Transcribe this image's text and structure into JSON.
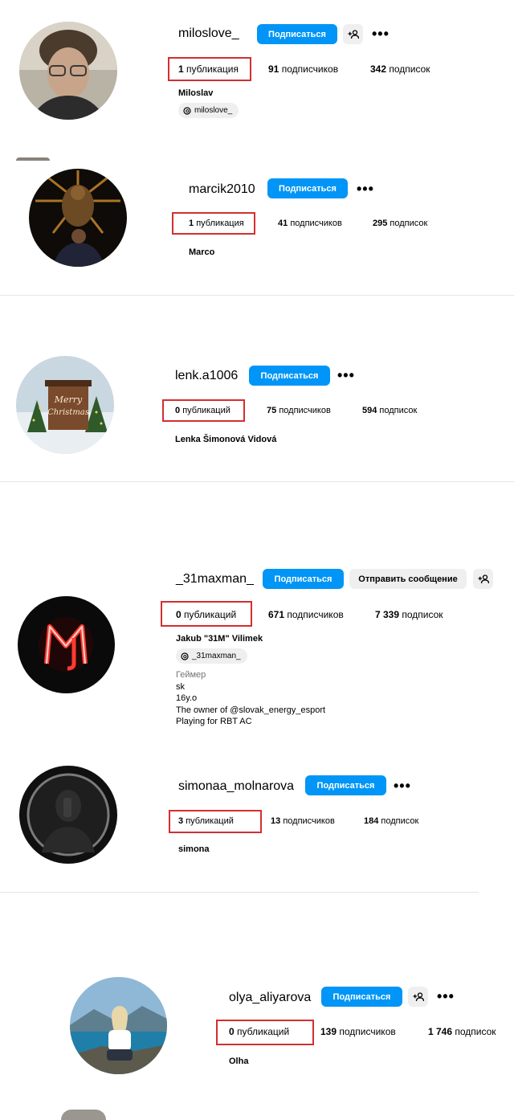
{
  "profiles": [
    {
      "username": "miloslove_",
      "subscribe_label": "Подписаться",
      "posts_count": "1",
      "posts_label": "публикация",
      "followers_count": "91",
      "followers_label": "подписчиков",
      "following_count": "342",
      "following_label": "подписок",
      "full_name": "Miloslav",
      "threads_handle": "miloslove_"
    },
    {
      "username": "marcik2010",
      "subscribe_label": "Подписаться",
      "posts_count": "1",
      "posts_label": "публикация",
      "followers_count": "41",
      "followers_label": "подписчиков",
      "following_count": "295",
      "following_label": "подписок",
      "full_name": "Marco"
    },
    {
      "username": "lenk.a1006",
      "subscribe_label": "Подписаться",
      "posts_count": "0",
      "posts_label": "публикаций",
      "followers_count": "75",
      "followers_label": "подписчиков",
      "following_count": "594",
      "following_label": "подписок",
      "full_name": "Lenka Šimonová Vidová",
      "avatar_text": [
        "Merry",
        "Christmas"
      ]
    },
    {
      "username": "_31maxman_",
      "subscribe_label": "Подписаться",
      "message_label": "Отправить сообщение",
      "posts_count": "0",
      "posts_label": "публикаций",
      "followers_count": "671",
      "followers_label": "подписчиков",
      "following_count": "7 339",
      "following_label": "подписок",
      "full_name": "Jakub \"31M\" Vilimek",
      "threads_handle": "_31maxman_",
      "category": "Геймер",
      "bio_lines": [
        "sk",
        "16y.o",
        "The owner of @slovak_energy_esport",
        "Playing for RBT AC"
      ]
    },
    {
      "username": "simonaa_molnarova",
      "subscribe_label": "Подписаться",
      "posts_count": "3",
      "posts_label": "публикаций",
      "followers_count": "13",
      "followers_label": "подписчиков",
      "following_count": "184",
      "following_label": "подписок",
      "full_name": "simona"
    },
    {
      "username": "olya_aliyarova",
      "subscribe_label": "Подписаться",
      "posts_count": "0",
      "posts_label": "публикаций",
      "followers_count": "139",
      "followers_label": "подписчиков",
      "following_count": "1 746",
      "following_label": "подписок",
      "full_name": "Olha"
    }
  ],
  "icons": {
    "add_user": "add-user-icon",
    "more": "more-options-icon",
    "threads": "threads-icon"
  },
  "colors": {
    "primary_button": "#0095f6",
    "secondary_button": "#efefef",
    "highlight_box": "#d32f2f",
    "category_text": "#737373"
  }
}
